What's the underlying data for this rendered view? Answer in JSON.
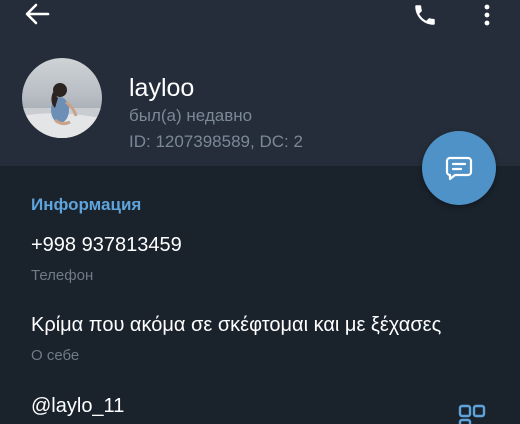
{
  "profile": {
    "name": "layloo",
    "status": "был(а) недавно",
    "id_line": "ID: 1207398589, DC: 2"
  },
  "info": {
    "section_title": "Информация",
    "phone_value": "+998 937813459",
    "phone_label": "Телефон",
    "bio_value": "Κρίμα που ακόμα σε σκέφτομαι και με ξέχασες",
    "bio_label": "О себе",
    "username_value": "@laylo_11"
  },
  "icons": {
    "back": "arrow-left-icon",
    "call": "phone-icon",
    "more": "more-vertical-icon",
    "message": "message-icon",
    "qr": "qr-code-icon"
  },
  "colors": {
    "background": "#1a222c",
    "header": "#242d39",
    "accent": "#5ea3da",
    "fab": "#4e92c8"
  }
}
